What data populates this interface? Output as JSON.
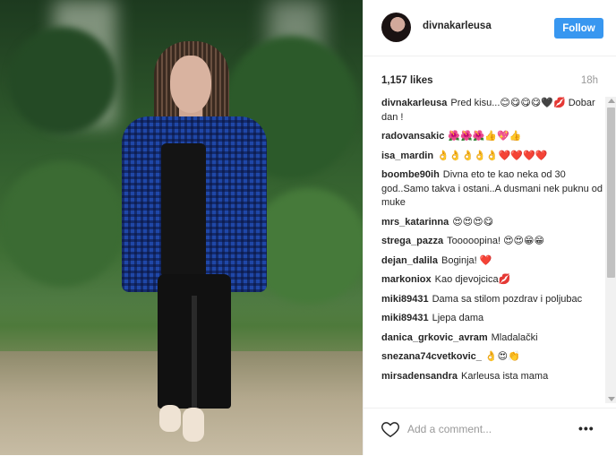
{
  "post": {
    "username": "divnakarleusa",
    "follow_label": "Follow",
    "likes": "1,157 likes",
    "time": "18h"
  },
  "comments": [
    {
      "user": "divnakarleusa",
      "text": "Pred kisu...😊😋😋😋🖤💋 Dobar dan !"
    },
    {
      "user": "radovansakic",
      "text": "🌺🌺🌺👍💖👍"
    },
    {
      "user": "isa_mardin",
      "text": "👌👌👌👌👌❤️❤️❤️❤️"
    },
    {
      "user": "boombe90ih",
      "text": "Divna eto te kao neka od 30 god..Samo takva i ostani..A dusmani nek puknu od muke"
    },
    {
      "user": "mrs_katarinna",
      "text": "😍😍😍😋"
    },
    {
      "user": "strega_pazza",
      "text": "Tooooopina! 😍😍😁😁"
    },
    {
      "user": "dejan_dalila",
      "text": "Boginja! ❤️"
    },
    {
      "user": "markoniox",
      "text": "Kao djevojcica💋"
    },
    {
      "user": "miki89431",
      "text": "Dama sa stilom pozdrav i poljubac"
    },
    {
      "user": "miki89431",
      "text": "Ljepa dama"
    },
    {
      "user": "danica_grkovic_avram",
      "text": "Mladalački"
    },
    {
      "user": "snezana74cvetkovic_",
      "text": "👌😍👏"
    },
    {
      "user": "mirsadensandra",
      "text": "Karleusa ista mama"
    }
  ],
  "footer": {
    "add_comment_placeholder": "Add a comment...",
    "more_label": "•••"
  },
  "colors": {
    "follow_button": "#3897f0",
    "text": "#262626",
    "muted": "#999999",
    "border": "#efefef"
  },
  "icons": {
    "like": "heart-icon",
    "more": "more-options-icon"
  }
}
